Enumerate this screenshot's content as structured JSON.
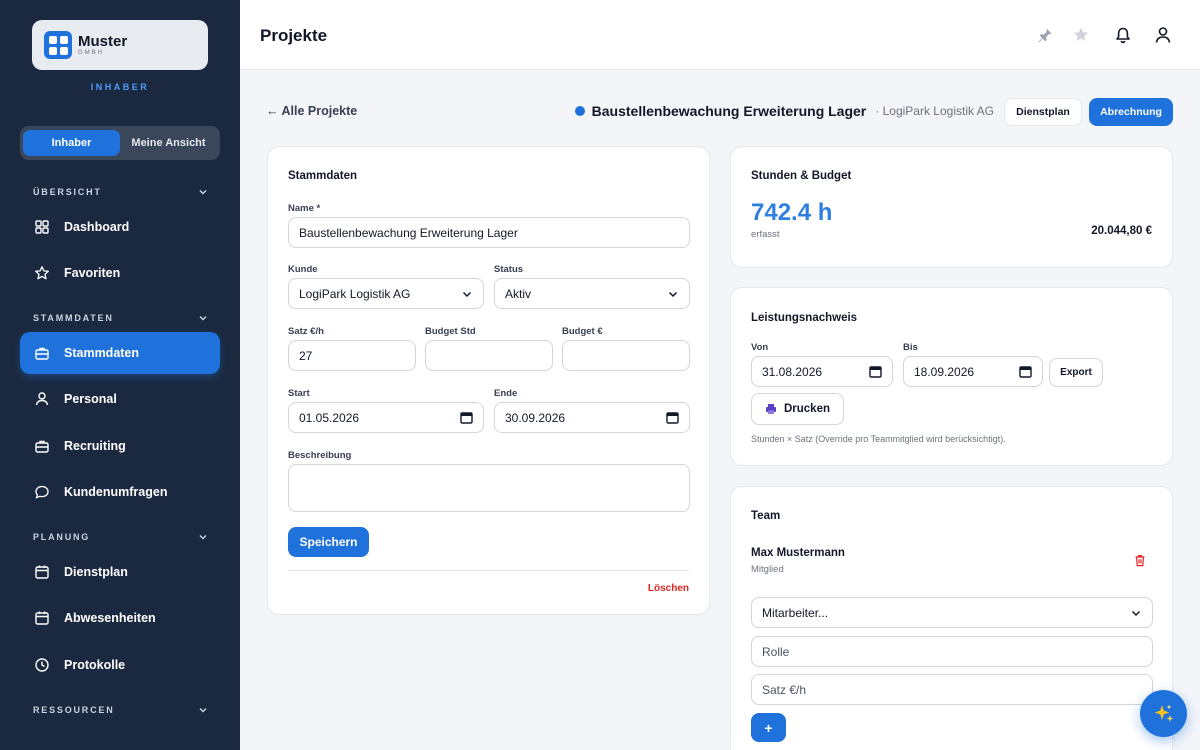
{
  "brand": {
    "name": "Muster",
    "sub": "GMBH",
    "role": "INHABER"
  },
  "view_toggle": {
    "owner": "Inhaber",
    "mine": "Meine Ansicht"
  },
  "sidebar": {
    "sections": {
      "overview": "ÜBERSICHT",
      "master": "STAMMDATEN",
      "planning": "PLANUNG",
      "resources": "RESSOURCEN"
    },
    "items": {
      "dashboard": "Dashboard",
      "favorites": "Favoriten",
      "stammdaten": "Stammdaten",
      "personal": "Personal",
      "recruiting": "Recruiting",
      "surveys": "Kundenumfragen",
      "dienstplan": "Dienstplan",
      "absences": "Abwesenheiten",
      "protocols": "Protokolle"
    }
  },
  "topbar": {
    "title": "Projekte"
  },
  "header": {
    "back": "← Alle Projekte",
    "project_name": "Baustellenbewachung Erweiterung Lager",
    "client": "· LogiPark Logistik AG",
    "btn_dienstplan": "Dienstplan",
    "btn_abrechnung": "Abrechnung"
  },
  "stammdaten": {
    "title": "Stammdaten",
    "name_label": "Name *",
    "name_value": "Baustellenbewachung Erweiterung Lager",
    "kunde_label": "Kunde",
    "kunde_value": "LogiPark Logistik AG",
    "status_label": "Status",
    "status_value": "Aktiv",
    "satz_label": "Satz €/h",
    "satz_value": "27",
    "budget_std_label": "Budget Std",
    "budget_std_value": "",
    "budget_eur_label": "Budget €",
    "budget_eur_value": "",
    "start_label": "Start",
    "start_value": "01.05.2026",
    "ende_label": "Ende",
    "ende_value": "30.09.2026",
    "beschreibung_label": "Beschreibung",
    "beschreibung_value": "",
    "save": "Speichern",
    "delete": "Löschen"
  },
  "stunden": {
    "title": "Stunden & Budget",
    "hours": "742.4 h",
    "hours_sub": "erfasst",
    "amount": "20.044,80 €"
  },
  "leistung": {
    "title": "Leistungsnachweis",
    "von_label": "Von",
    "von_value": "31.08.2026",
    "bis_label": "Bis",
    "bis_value": "18.09.2026",
    "export": "Export",
    "print": "Drucken",
    "hint": "Stunden × Satz (Override pro Teammitglied wird berücksichtigt)."
  },
  "team": {
    "title": "Team",
    "member_name": "Max Mustermann",
    "member_role": "Mitglied",
    "employee_select": "Mitarbeiter...",
    "role_placeholder": "Rolle",
    "rate_placeholder": "Satz €/h",
    "add": "+"
  },
  "colors": {
    "sidebar": "#1b2940",
    "accent": "#1f72db",
    "danger": "#dc2626"
  }
}
